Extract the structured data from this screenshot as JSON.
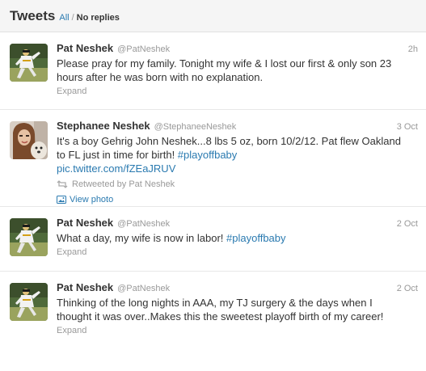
{
  "header": {
    "title": "Tweets",
    "filter_all": "All",
    "filter_sep": "/",
    "filter_no_replies": "No replies"
  },
  "colors": {
    "link": "#2a7ab0",
    "muted": "#999999",
    "text": "#333333"
  },
  "tweets": [
    {
      "name": "Pat Neshek",
      "handle": "@PatNeshek",
      "time": "2h",
      "text": "Please pray for my family. Tonight my wife & I lost our first & only son 23 hours after he was born with no explanation.",
      "action": "Expand",
      "avatar_icon": "baseball-pitcher-avatar"
    },
    {
      "name": "Stephanee Neshek",
      "handle": "@StephaneeNeshek",
      "time": "3 Oct",
      "text": "It's a boy Gehrig John Neshek...8 lbs 5 oz, born 10/2/12. Pat flew Oakland to FL just in time for birth! ",
      "hashtag": "#playoffbaby",
      "link": "pic.twitter.com/fZEaJRUV",
      "retweeted_by": "Retweeted by Pat Neshek",
      "view_photo": "View photo",
      "avatar_icon": "woman-with-dog-avatar"
    },
    {
      "name": "Pat Neshek",
      "handle": "@PatNeshek",
      "time": "2 Oct",
      "text": "What a day, my wife is now in labor! ",
      "hashtag": "#playoffbaby",
      "action": "Expand",
      "avatar_icon": "baseball-pitcher-avatar"
    },
    {
      "name": "Pat Neshek",
      "handle": "@PatNeshek",
      "time": "2 Oct",
      "text": "Thinking of the long nights in AAA, my TJ surgery & the days when I thought it was over..Makes this the sweetest playoff birth of my career!",
      "action": "Expand",
      "avatar_icon": "baseball-pitcher-avatar"
    }
  ]
}
